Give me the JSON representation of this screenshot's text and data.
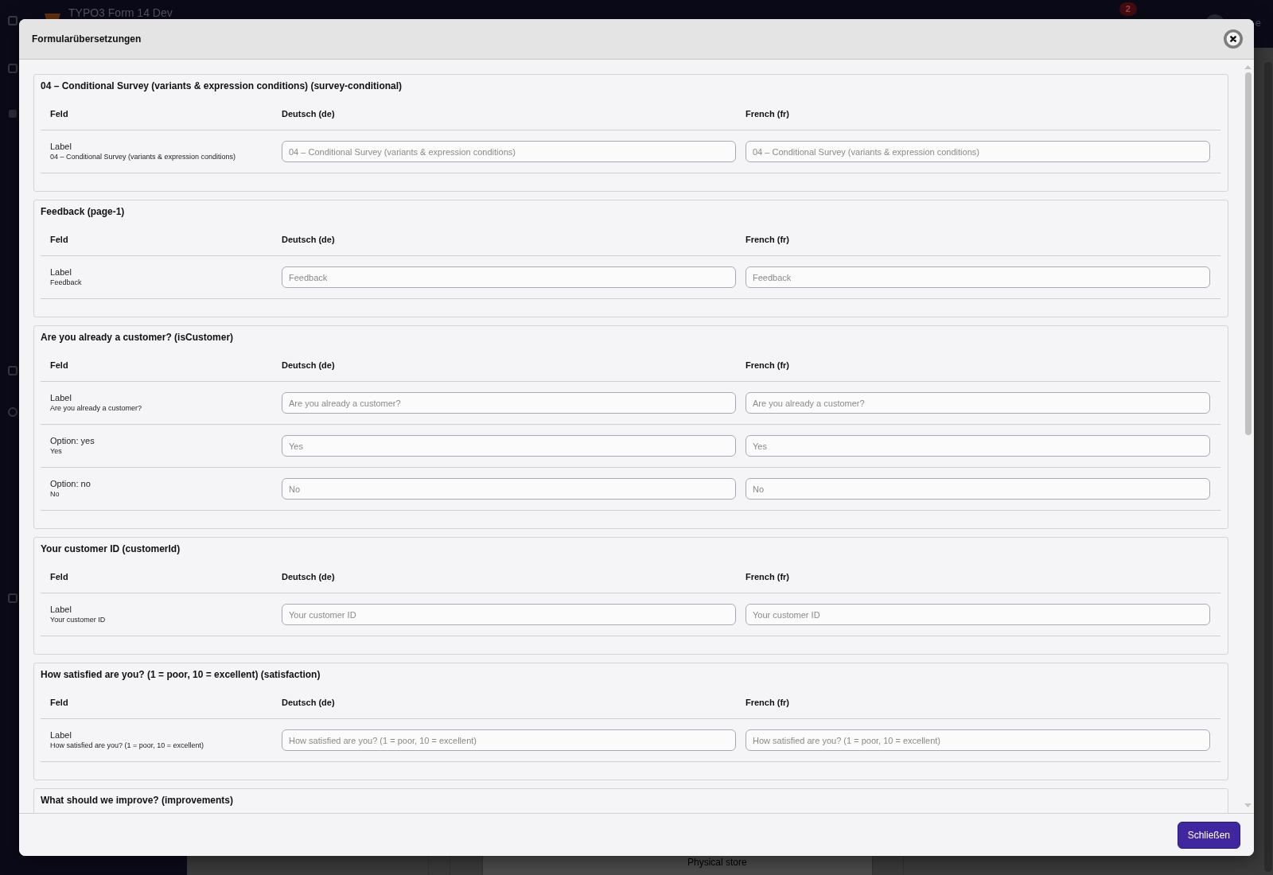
{
  "backdrop": {
    "topbar": {
      "site_title": "TYPO3 Form 14 Dev",
      "notification_count": "2",
      "user_label": "e"
    },
    "content": {
      "panel_text": "Physical store"
    }
  },
  "modal": {
    "title": "Formularübersetzungen",
    "sections": [
      {
        "title": "04 – Conditional Survey (variants & expression conditions) (survey-conditional)",
        "columns": [
          "Feld",
          "Deutsch (de)",
          "French (fr)"
        ],
        "rows": [
          {
            "field": "Label",
            "source": "04 – Conditional Survey (variants & expression conditions)",
            "inputs": [
              {
                "placeholder": "04 – Conditional Survey (variants & expression conditions)"
              },
              {
                "placeholder": "04 – Conditional Survey (variants & expression conditions)"
              }
            ]
          }
        ]
      },
      {
        "title": "Feedback (page-1)",
        "columns": [
          "Feld",
          "Deutsch (de)",
          "French (fr)"
        ],
        "rows": [
          {
            "field": "Label",
            "source": "Feedback",
            "inputs": [
              {
                "placeholder": "Feedback"
              },
              {
                "placeholder": "Feedback"
              }
            ]
          }
        ]
      },
      {
        "title": "Are you already a customer? (isCustomer)",
        "columns": [
          "Feld",
          "Deutsch (de)",
          "French (fr)"
        ],
        "rows": [
          {
            "field": "Label",
            "source": "Are you already a customer?",
            "inputs": [
              {
                "placeholder": "Are you already a customer?"
              },
              {
                "placeholder": "Are you already a customer?"
              }
            ]
          },
          {
            "field": "Option: yes",
            "source": "Yes",
            "inputs": [
              {
                "placeholder": "Yes"
              },
              {
                "placeholder": "Yes"
              }
            ]
          },
          {
            "field": "Option: no",
            "source": "No",
            "inputs": [
              {
                "placeholder": "No"
              },
              {
                "placeholder": "No"
              }
            ]
          }
        ]
      },
      {
        "title": "Your customer ID (customerId)",
        "columns": [
          "Feld",
          "Deutsch (de)",
          "French (fr)"
        ],
        "rows": [
          {
            "field": "Label",
            "source": "Your customer ID",
            "inputs": [
              {
                "placeholder": "Your customer ID"
              },
              {
                "placeholder": "Your customer ID"
              }
            ]
          }
        ]
      },
      {
        "title": "How satisfied are you? (1 = poor, 10 = excellent) (satisfaction)",
        "columns": [
          "Feld",
          "Deutsch (de)",
          "French (fr)"
        ],
        "rows": [
          {
            "field": "Label",
            "source": "How satisfied are you? (1 = poor, 10 = excellent)",
            "inputs": [
              {
                "placeholder": "How satisfied are you? (1 = poor, 10 = excellent)"
              },
              {
                "placeholder": "How satisfied are you? (1 = poor, 10 = excellent)"
              }
            ]
          }
        ]
      },
      {
        "title": "What should we improve? (improvements)"
      }
    ],
    "footer_button": "Schließen"
  }
}
